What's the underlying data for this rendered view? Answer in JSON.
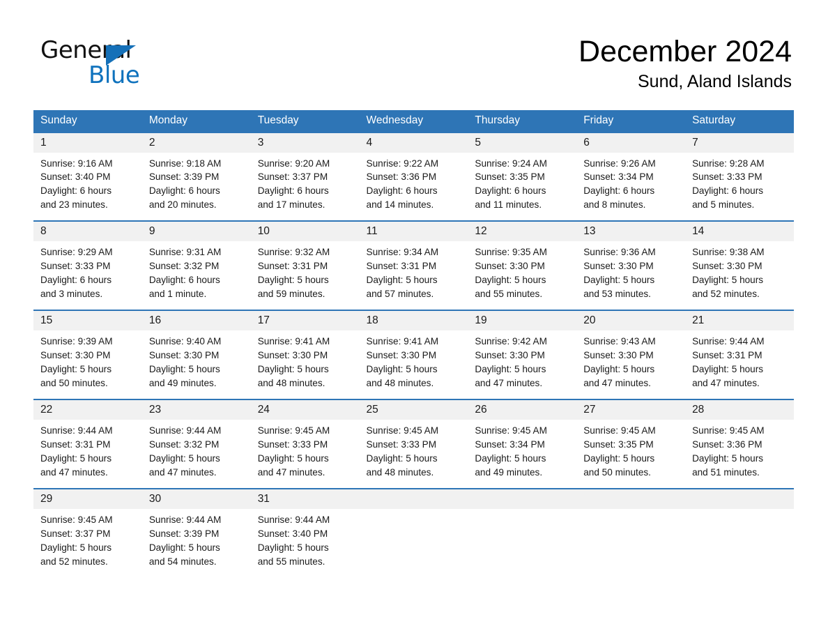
{
  "brand": {
    "name_part1": "General",
    "name_part2": "Blue",
    "logo_icon": "triangle-logo-icon",
    "accent_color": "#1570b8"
  },
  "header": {
    "month_title": "December 2024",
    "location": "Sund, Aland Islands"
  },
  "theme": {
    "header_blue": "#2e75b6",
    "daynum_gray": "#f1f1f1",
    "text_black": "#1a1a1a"
  },
  "calendar": {
    "weekday_headers": [
      "Sunday",
      "Monday",
      "Tuesday",
      "Wednesday",
      "Thursday",
      "Friday",
      "Saturday"
    ],
    "weeks": [
      [
        {
          "day": "1",
          "info": "Sunrise: 9:16 AM\nSunset: 3:40 PM\nDaylight: 6 hours\nand 23 minutes."
        },
        {
          "day": "2",
          "info": "Sunrise: 9:18 AM\nSunset: 3:39 PM\nDaylight: 6 hours\nand 20 minutes."
        },
        {
          "day": "3",
          "info": "Sunrise: 9:20 AM\nSunset: 3:37 PM\nDaylight: 6 hours\nand 17 minutes."
        },
        {
          "day": "4",
          "info": "Sunrise: 9:22 AM\nSunset: 3:36 PM\nDaylight: 6 hours\nand 14 minutes."
        },
        {
          "day": "5",
          "info": "Sunrise: 9:24 AM\nSunset: 3:35 PM\nDaylight: 6 hours\nand 11 minutes."
        },
        {
          "day": "6",
          "info": "Sunrise: 9:26 AM\nSunset: 3:34 PM\nDaylight: 6 hours\nand 8 minutes."
        },
        {
          "day": "7",
          "info": "Sunrise: 9:28 AM\nSunset: 3:33 PM\nDaylight: 6 hours\nand 5 minutes."
        }
      ],
      [
        {
          "day": "8",
          "info": "Sunrise: 9:29 AM\nSunset: 3:33 PM\nDaylight: 6 hours\nand 3 minutes."
        },
        {
          "day": "9",
          "info": "Sunrise: 9:31 AM\nSunset: 3:32 PM\nDaylight: 6 hours\nand 1 minute."
        },
        {
          "day": "10",
          "info": "Sunrise: 9:32 AM\nSunset: 3:31 PM\nDaylight: 5 hours\nand 59 minutes."
        },
        {
          "day": "11",
          "info": "Sunrise: 9:34 AM\nSunset: 3:31 PM\nDaylight: 5 hours\nand 57 minutes."
        },
        {
          "day": "12",
          "info": "Sunrise: 9:35 AM\nSunset: 3:30 PM\nDaylight: 5 hours\nand 55 minutes."
        },
        {
          "day": "13",
          "info": "Sunrise: 9:36 AM\nSunset: 3:30 PM\nDaylight: 5 hours\nand 53 minutes."
        },
        {
          "day": "14",
          "info": "Sunrise: 9:38 AM\nSunset: 3:30 PM\nDaylight: 5 hours\nand 52 minutes."
        }
      ],
      [
        {
          "day": "15",
          "info": "Sunrise: 9:39 AM\nSunset: 3:30 PM\nDaylight: 5 hours\nand 50 minutes."
        },
        {
          "day": "16",
          "info": "Sunrise: 9:40 AM\nSunset: 3:30 PM\nDaylight: 5 hours\nand 49 minutes."
        },
        {
          "day": "17",
          "info": "Sunrise: 9:41 AM\nSunset: 3:30 PM\nDaylight: 5 hours\nand 48 minutes."
        },
        {
          "day": "18",
          "info": "Sunrise: 9:41 AM\nSunset: 3:30 PM\nDaylight: 5 hours\nand 48 minutes."
        },
        {
          "day": "19",
          "info": "Sunrise: 9:42 AM\nSunset: 3:30 PM\nDaylight: 5 hours\nand 47 minutes."
        },
        {
          "day": "20",
          "info": "Sunrise: 9:43 AM\nSunset: 3:30 PM\nDaylight: 5 hours\nand 47 minutes."
        },
        {
          "day": "21",
          "info": "Sunrise: 9:44 AM\nSunset: 3:31 PM\nDaylight: 5 hours\nand 47 minutes."
        }
      ],
      [
        {
          "day": "22",
          "info": "Sunrise: 9:44 AM\nSunset: 3:31 PM\nDaylight: 5 hours\nand 47 minutes."
        },
        {
          "day": "23",
          "info": "Sunrise: 9:44 AM\nSunset: 3:32 PM\nDaylight: 5 hours\nand 47 minutes."
        },
        {
          "day": "24",
          "info": "Sunrise: 9:45 AM\nSunset: 3:33 PM\nDaylight: 5 hours\nand 47 minutes."
        },
        {
          "day": "25",
          "info": "Sunrise: 9:45 AM\nSunset: 3:33 PM\nDaylight: 5 hours\nand 48 minutes."
        },
        {
          "day": "26",
          "info": "Sunrise: 9:45 AM\nSunset: 3:34 PM\nDaylight: 5 hours\nand 49 minutes."
        },
        {
          "day": "27",
          "info": "Sunrise: 9:45 AM\nSunset: 3:35 PM\nDaylight: 5 hours\nand 50 minutes."
        },
        {
          "day": "28",
          "info": "Sunrise: 9:45 AM\nSunset: 3:36 PM\nDaylight: 5 hours\nand 51 minutes."
        }
      ],
      [
        {
          "day": "29",
          "info": "Sunrise: 9:45 AM\nSunset: 3:37 PM\nDaylight: 5 hours\nand 52 minutes."
        },
        {
          "day": "30",
          "info": "Sunrise: 9:44 AM\nSunset: 3:39 PM\nDaylight: 5 hours\nand 54 minutes."
        },
        {
          "day": "31",
          "info": "Sunrise: 9:44 AM\nSunset: 3:40 PM\nDaylight: 5 hours\nand 55 minutes."
        },
        {
          "day": "",
          "info": ""
        },
        {
          "day": "",
          "info": ""
        },
        {
          "day": "",
          "info": ""
        },
        {
          "day": "",
          "info": ""
        }
      ]
    ]
  }
}
